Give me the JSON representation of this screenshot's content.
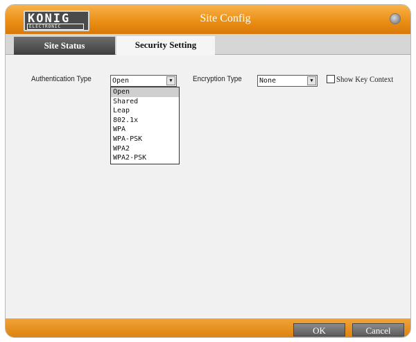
{
  "window": {
    "title": "Site Config",
    "logo_top": "KONIG",
    "logo_bottom": "ELECTRONIC"
  },
  "tabs": [
    {
      "label": "Site Status",
      "active": false
    },
    {
      "label": "Security Setting",
      "active": true
    }
  ],
  "auth": {
    "label": "Authentication Type",
    "value": "Open",
    "options": [
      "Open",
      "Shared",
      "Leap",
      "802.1x",
      "WPA",
      "WPA-PSK",
      "WPA2",
      "WPA2-PSK"
    ],
    "highlighted": "Open"
  },
  "encryption": {
    "label": "Encryption Type",
    "value": "None"
  },
  "show_key": {
    "label": "Show Key Context",
    "checked": false
  },
  "footer": {
    "ok_label": "OK",
    "cancel_label": "Cancel"
  },
  "colors": {
    "accent": "#e98d12",
    "tab_active_bg": "#f5f5f5",
    "tab_inactive_bg": "#3e3e3e"
  },
  "icons": {
    "close": "close-icon",
    "dropdown_arrow": "chevron-down-icon"
  }
}
